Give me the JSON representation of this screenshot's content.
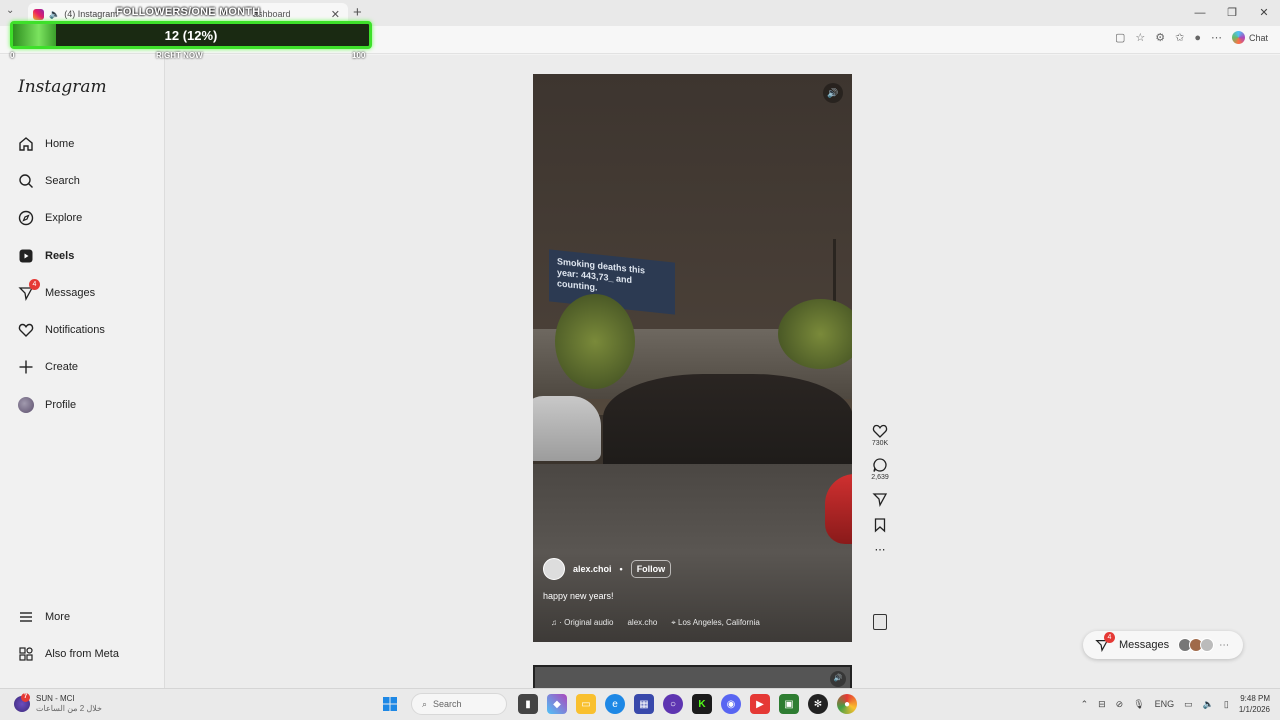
{
  "browser": {
    "tab_title": "(4) Instagram",
    "tab2_fragment": "ashboard",
    "new_tab_symbol": "+",
    "chat_label": "Chat"
  },
  "overlay": {
    "title": "FOLLOWERS/ONE MONTH",
    "value_text": "12 (12%)",
    "progress_fraction": 0.12,
    "min_label": "0",
    "mid_label": "RIGHT NOW",
    "max_label": "100",
    "accent_color": "#3ee02a"
  },
  "instagram": {
    "logo": "Instagram",
    "nav": [
      {
        "label": "Home",
        "icon": "home-icon"
      },
      {
        "label": "Search",
        "icon": "search-icon"
      },
      {
        "label": "Explore",
        "icon": "compass-icon"
      },
      {
        "label": "Reels",
        "icon": "reels-icon",
        "active": true
      },
      {
        "label": "Messages",
        "icon": "messenger-icon",
        "badge": "4"
      },
      {
        "label": "Notifications",
        "icon": "heart-icon"
      },
      {
        "label": "Create",
        "icon": "plus-icon"
      },
      {
        "label": "Profile",
        "icon": "avatar"
      }
    ],
    "nav_bottom": [
      {
        "label": "More",
        "icon": "menu-icon"
      },
      {
        "label": "Also from Meta",
        "icon": "meta-grid-icon"
      }
    ]
  },
  "reel": {
    "billboard_text": "Smoking deaths this year: 443,73_ and counting.",
    "author": "alex.choi",
    "separator": "•",
    "follow_label": "Follow",
    "caption": "happy new years!",
    "audio": "♫ · Original audio",
    "audio_author": "alex.cho",
    "location": "Los Angeles, California",
    "likes": "730K",
    "comments": "2,639"
  },
  "messages_pill": {
    "label": "Messages",
    "badge": "4"
  },
  "taskbar": {
    "weather_title": "SUN - MCI",
    "weather_sub": "خلال 2 من الساعات",
    "weather_badge": "7",
    "search_placeholder": "Search",
    "language": "ENG",
    "time": "9:48 PM",
    "date": "1/1/2026"
  }
}
